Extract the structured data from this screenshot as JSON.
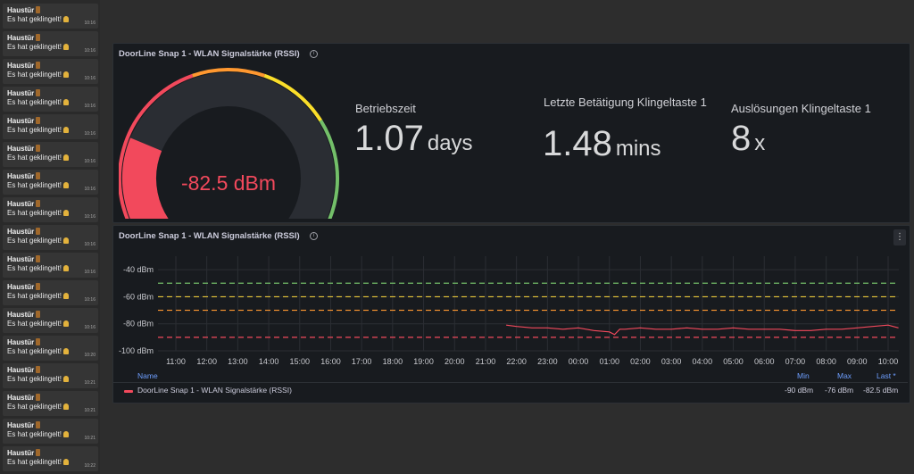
{
  "notifications": [
    {
      "title": "Haustür",
      "message": "Es hat geklingelt!",
      "time": "10:16"
    },
    {
      "title": "Haustür",
      "message": "Es hat geklingelt!",
      "time": "10:16"
    },
    {
      "title": "Haustür",
      "message": "Es hat geklingelt!",
      "time": "10:16"
    },
    {
      "title": "Haustür",
      "message": "Es hat geklingelt!",
      "time": "10:16"
    },
    {
      "title": "Haustür",
      "message": "Es hat geklingelt!",
      "time": "10:16"
    },
    {
      "title": "Haustür",
      "message": "Es hat geklingelt!",
      "time": "10:16"
    },
    {
      "title": "Haustür",
      "message": "Es hat geklingelt!",
      "time": "10:16"
    },
    {
      "title": "Haustür",
      "message": "Es hat geklingelt!",
      "time": "10:16"
    },
    {
      "title": "Haustür",
      "message": "Es hat geklingelt!",
      "time": "10:16"
    },
    {
      "title": "Haustür",
      "message": "Es hat geklingelt!",
      "time": "10:16"
    },
    {
      "title": "Haustür",
      "message": "Es hat geklingelt!",
      "time": "10:16"
    },
    {
      "title": "Haustür",
      "message": "Es hat geklingelt!",
      "time": "10:16"
    },
    {
      "title": "Haustür",
      "message": "Es hat geklingelt!",
      "time": "10:20"
    },
    {
      "title": "Haustür",
      "message": "Es hat geklingelt!",
      "time": "10:21"
    },
    {
      "title": "Haustür",
      "message": "Es hat geklingelt!",
      "time": "10:21"
    },
    {
      "title": "Haustür",
      "message": "Es hat geklingelt!",
      "time": "10:21"
    },
    {
      "title": "Haustür",
      "message": "Es hat geklingelt!",
      "time": "10:22"
    }
  ],
  "gauge": {
    "title": "DoorLine Snap 1 - WLAN Signalstärke (RSSI)",
    "value": -82.5,
    "value_text": "-82.5 dBm",
    "min": -100,
    "max": -30,
    "value_color": "#f2495c"
  },
  "stats": [
    {
      "label": "Betriebszeit",
      "value": "1.07",
      "unit": "days"
    },
    {
      "label": "Letzte Betätigung Klingeltaste 1",
      "value": "1.48",
      "unit": "mins"
    },
    {
      "label": "Auslösungen Klingeltaste 1",
      "value": "8",
      "unit": "x"
    }
  ],
  "timeseries": {
    "title": "DoorLine Snap 1 - WLAN Signalstärke (RSSI)",
    "menu_icon": "kebab-menu-icon",
    "legend": {
      "headers": {
        "name": "Name",
        "min": "Min",
        "max": "Max",
        "last": "Last *"
      },
      "series": {
        "name": "DoorLine Snap 1 - WLAN Signalstärke (RSSI)",
        "min": "-90 dBm",
        "max": "-76 dBm",
        "last": "-82.5 dBm",
        "color": "#f2495c"
      }
    }
  },
  "chart_data": {
    "type": "line",
    "title": "DoorLine Snap 1 - WLAN Signalstärke (RSSI)",
    "y_ticks": [
      "-40 dBm",
      "-60 dBm",
      "-80 dBm",
      "-100 dBm"
    ],
    "ylim": [
      -100,
      -30
    ],
    "x_ticks": [
      "11:00",
      "12:00",
      "13:00",
      "14:00",
      "15:00",
      "16:00",
      "17:00",
      "18:00",
      "19:00",
      "20:00",
      "21:00",
      "22:00",
      "23:00",
      "00:00",
      "01:00",
      "02:00",
      "03:00",
      "04:00",
      "05:00",
      "06:00",
      "07:00",
      "08:00",
      "09:00",
      "10:00"
    ],
    "threshold_lines": [
      {
        "value": -50,
        "color": "#73bf69"
      },
      {
        "value": -60,
        "color": "#e8c83a"
      },
      {
        "value": -70,
        "color": "#ff9830"
      },
      {
        "value": -90,
        "color": "#f2495c"
      }
    ],
    "grid": true,
    "series": [
      {
        "name": "DoorLine Snap 1 - WLAN Signalstärke (RSSI)",
        "color": "#f2495c",
        "x": [
          "21:40",
          "22:00",
          "22:30",
          "23:00",
          "23:30",
          "00:00",
          "00:30",
          "01:00",
          "01:10",
          "01:20",
          "01:30",
          "02:00",
          "02:30",
          "03:00",
          "03:30",
          "04:00",
          "04:30",
          "05:00",
          "05:30",
          "06:00",
          "06:30",
          "07:00",
          "07:30",
          "08:00",
          "08:30",
          "09:00",
          "09:30",
          "10:00",
          "10:20"
        ],
        "values": [
          -81,
          -82,
          -83,
          -83,
          -84,
          -83,
          -85,
          -86,
          -88,
          -84,
          -84,
          -83,
          -84,
          -84,
          -83,
          -84,
          -84,
          -83,
          -84,
          -84,
          -84,
          -85,
          -85,
          -84,
          -84,
          -83,
          -82,
          -81,
          -83
        ]
      }
    ]
  }
}
